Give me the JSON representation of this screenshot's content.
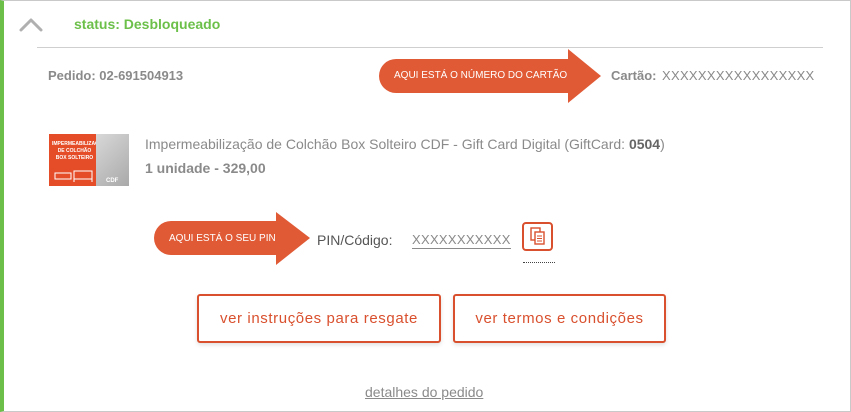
{
  "status": {
    "text": "status: Desbloqueado",
    "color": "#6cc04a"
  },
  "order": {
    "label": "Pedido: 02-691504913"
  },
  "card": {
    "arrow_text": "AQUI ESTÁ O NÚMERO DO CARTÃO",
    "label": "Cartão:",
    "number": "XXXXXXXXXXXXXXXXX"
  },
  "product": {
    "thumb_title": "IMPERMEABILIZAÇÃO DE COLCHÃO BOX SOLTEIRO",
    "thumb_brand": "CDF",
    "name_prefix": "Impermeabilização de Colchão Box Solteiro CDF - Gift Card Digital (GiftCard: ",
    "giftcard_code": "0504",
    "name_suffix": ")",
    "quantity_price": "1 unidade - 329,00"
  },
  "pin": {
    "arrow_text": "AQUI ESTÁ O SEU PIN",
    "label": "PIN/Código:",
    "value": "XXXXXXXXXXX"
  },
  "buttons": {
    "instructions": "ver instruções para resgate",
    "terms": "ver termos e condições"
  },
  "footer": {
    "details_link": "detalhes do pedido"
  },
  "colors": {
    "accent": "#d9502e",
    "arrow": "#e05a36",
    "status": "#6cc04a",
    "text_muted": "#8a8a8a"
  },
  "icons": {
    "collapse": "chevron-up-icon",
    "copy": "copy-icon"
  }
}
